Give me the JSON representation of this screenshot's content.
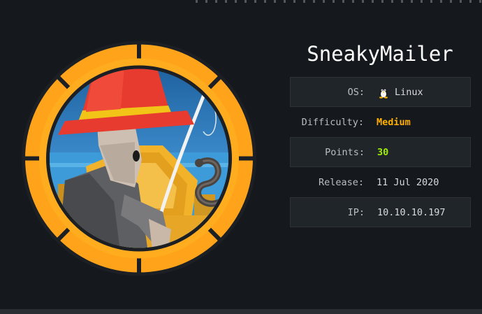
{
  "machine": {
    "name": "SneakyMailer"
  },
  "info": {
    "os_label": "OS:",
    "os_value": "Linux",
    "os_icon": "tux-penguin-icon",
    "difficulty_label": "Difficulty:",
    "difficulty_value": "Medium",
    "points_label": "Points:",
    "points_value": "30",
    "release_label": "Release:",
    "release_value": "11 Jul 2020",
    "ip_label": "IP:",
    "ip_value": "10.10.10.197"
  },
  "colors": {
    "background": "#15181c",
    "medium": "#ffaf00",
    "points": "#9fef00",
    "ring": "#ffa500",
    "hat": "#e63b2e"
  }
}
